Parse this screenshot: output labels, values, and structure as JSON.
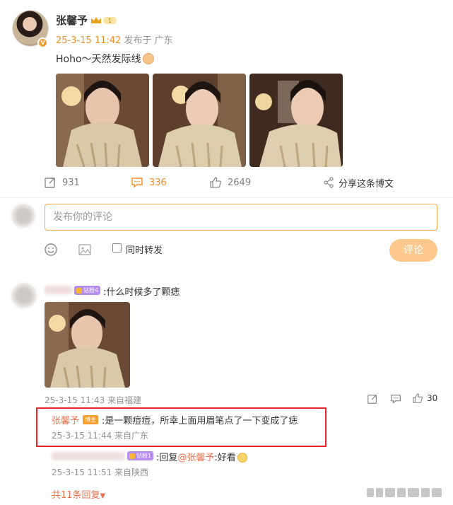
{
  "post": {
    "author": "张馨予",
    "time": "25-3-15 11:42",
    "location": "发布于 广东",
    "text": "Hoho～天然发际线",
    "photo_count": 3
  },
  "actions": {
    "repost_count": "931",
    "comment_count": "336",
    "like_count": "2649",
    "share_label": "分享这条博文"
  },
  "composer": {
    "placeholder": "发布你的评论",
    "repost_label": "同时转发",
    "submit_label": "评论"
  },
  "comments": [
    {
      "badge": "钻粉4",
      "text": ":什么时候多了颗痣",
      "time": "25-3-15 11:43 来自福建",
      "like_count": "30",
      "replies": [
        {
          "name": "张馨予",
          "badge": "博主",
          "text": ":是一颗痘痘，所幸上面用眉笔点了一下变成了痣",
          "time": "25-3-15 11:44 来自广东"
        },
        {
          "badge": "钻粉1",
          "prefix": ":回复",
          "mention": "@张馨予",
          "suffix": ":好看",
          "time": "25-3-15 11:51 来自陕西"
        }
      ],
      "more_replies": "共11条回复"
    }
  ],
  "colors": {
    "accent": "#f38d26",
    "name_link": "#eb7350",
    "highlight_box": "#e5262b",
    "submit_disabled": "#fbc88e"
  }
}
